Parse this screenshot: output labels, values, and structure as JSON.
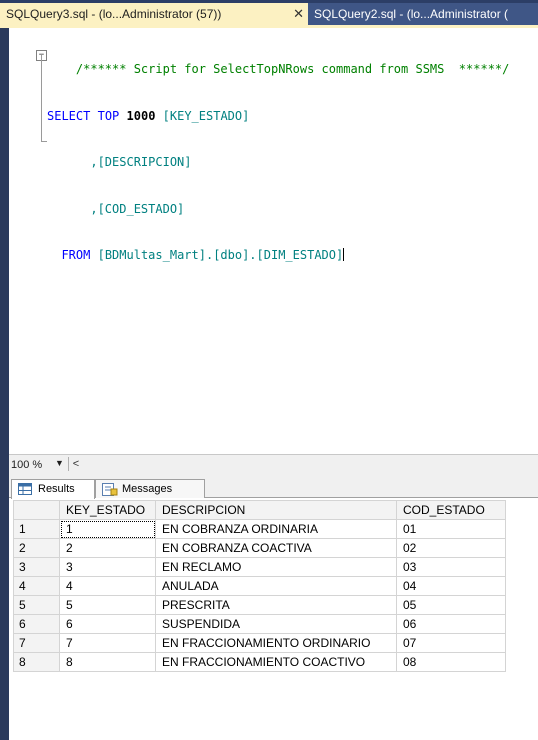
{
  "tabs": [
    {
      "label": "SQLQuery3.sql - (lo...Administrator (57))",
      "active": true
    },
    {
      "label": "SQLQuery2.sql - (lo...Administrator (",
      "active": false
    }
  ],
  "editor": {
    "comment": "/****** Script for SelectTopNRows command from SSMS  ******/",
    "line2_select": "SELECT",
    "line2_top": "TOP",
    "line2_num": "1000",
    "line2_col": "[KEY_ESTADO]",
    "line3": ",[DESCRIPCION]",
    "line4": ",[COD_ESTADO]",
    "line5_from": "FROM",
    "line5_obj": "[BDMultas_Mart].[dbo].[DIM_ESTADO]"
  },
  "zoom": {
    "value": "100 %"
  },
  "results_tabs": {
    "results": "Results",
    "messages": "Messages"
  },
  "grid": {
    "columns": [
      "KEY_ESTADO",
      "DESCRIPCION",
      "COD_ESTADO"
    ],
    "rows": [
      [
        "1",
        "1",
        "EN COBRANZA ORDINARIA",
        "01"
      ],
      [
        "2",
        "2",
        "EN COBRANZA COACTIVA",
        "02"
      ],
      [
        "3",
        "3",
        "EN RECLAMO",
        "03"
      ],
      [
        "4",
        "4",
        "ANULADA",
        "04"
      ],
      [
        "5",
        "5",
        "PRESCRITA",
        "05"
      ],
      [
        "6",
        "6",
        "SUSPENDIDA",
        "06"
      ],
      [
        "7",
        "7",
        "EN FRACCIONAMIENTO ORDINARIO",
        "07"
      ],
      [
        "8",
        "8",
        "EN FRACCIONAMIENTO COACTIVO",
        "08"
      ]
    ]
  },
  "icons": {
    "close": "close-icon",
    "grid": "grid-icon",
    "messages": "messages-icon"
  }
}
